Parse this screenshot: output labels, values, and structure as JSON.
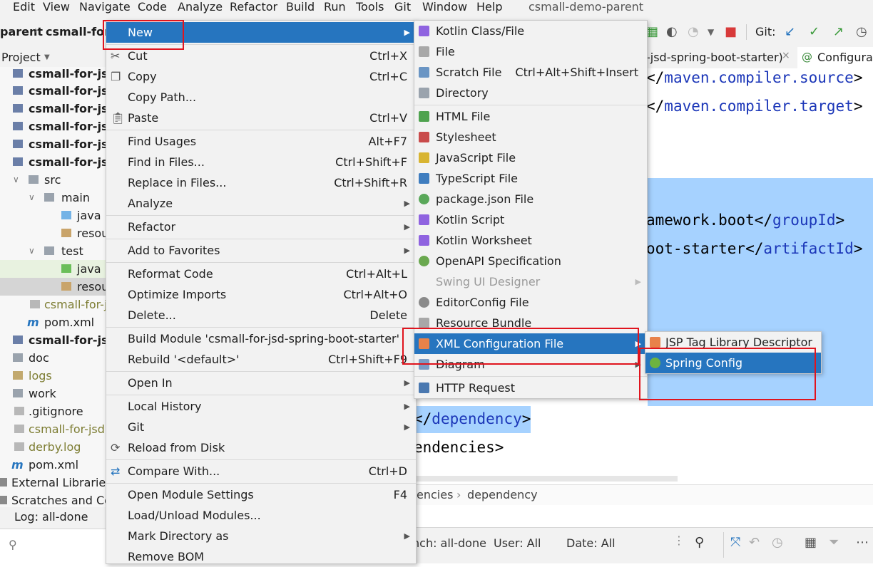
{
  "menubar": {
    "items": [
      "Edit",
      "View",
      "Navigate",
      "Code",
      "Analyze",
      "Refactor",
      "Build",
      "Run",
      "Tools",
      "Git",
      "Window",
      "Help"
    ],
    "app_title": "csmall-demo-parent"
  },
  "toolbar": {
    "breadcrumb_parent": "parent",
    "breadcrumb_module": "csmall-for",
    "git_label": "Git:"
  },
  "editor_tabs": {
    "tab1": "-jsd-spring-boot-starter)",
    "tab2": "Configura"
  },
  "project_panel": {
    "header": "Project",
    "rows": [
      "csmall-for-jsd",
      "csmall-for-jsd",
      "csmall-for-jsd",
      "csmall-for-jsd",
      "csmall-for-jsd",
      "csmall-for-jsd",
      "src",
      "main",
      "java",
      "resou",
      "test",
      "java",
      "resou",
      "csmall-for-j",
      "pom.xml",
      "csmall-for-jsd",
      "doc",
      "logs",
      "work",
      ".gitignore",
      "csmall-for-jsd.",
      "derby.log",
      "pom.xml",
      "External Libraries",
      "Scratches and Co"
    ]
  },
  "editor": {
    "line1_pre": "</",
    "line1_tag": "maven.compiler.source",
    "line1_post": ">",
    "line2_pre": "</",
    "line2_tag": "maven.compiler.target",
    "line2_post": ">",
    "line3_text": "amework.boot</",
    "line3_tag": "groupId",
    "line3_post": ">",
    "line4_text": "oot-starter</",
    "line4_tag": "artifactId",
    "line4_post": ">",
    "line5_pre": "</",
    "line5_tag": "dependency",
    "line5_post": ">",
    "line6_text": "endencies>"
  },
  "breadcrumb_bottom": {
    "item1": "encies",
    "item2": "dependency"
  },
  "git_panel": {
    "log_tab": "Log: all-done",
    "branch": "nch: all-done",
    "user": "User: All",
    "date": "Date: All"
  },
  "main_menu": {
    "items": [
      {
        "label": "New",
        "shortcut": ""
      },
      {
        "label": "Cut",
        "shortcut": "Ctrl+X"
      },
      {
        "label": "Copy",
        "shortcut": "Ctrl+C"
      },
      {
        "label": "Copy Path...",
        "shortcut": ""
      },
      {
        "label": "Paste",
        "shortcut": "Ctrl+V"
      },
      {
        "label": "Find Usages",
        "shortcut": "Alt+F7"
      },
      {
        "label": "Find in Files...",
        "shortcut": "Ctrl+Shift+F"
      },
      {
        "label": "Replace in Files...",
        "shortcut": "Ctrl+Shift+R"
      },
      {
        "label": "Analyze",
        "shortcut": ""
      },
      {
        "label": "Refactor",
        "shortcut": ""
      },
      {
        "label": "Add to Favorites",
        "shortcut": ""
      },
      {
        "label": "Reformat Code",
        "shortcut": "Ctrl+Alt+L"
      },
      {
        "label": "Optimize Imports",
        "shortcut": "Ctrl+Alt+O"
      },
      {
        "label": "Delete...",
        "shortcut": "Delete"
      },
      {
        "label": "Build Module 'csmall-for-jsd-spring-boot-starter'",
        "shortcut": ""
      },
      {
        "label": "Rebuild '<default>'",
        "shortcut": "Ctrl+Shift+F9"
      },
      {
        "label": "Open In",
        "shortcut": ""
      },
      {
        "label": "Local History",
        "shortcut": ""
      },
      {
        "label": "Git",
        "shortcut": ""
      },
      {
        "label": "Reload from Disk",
        "shortcut": ""
      },
      {
        "label": "Compare With...",
        "shortcut": "Ctrl+D"
      },
      {
        "label": "Open Module Settings",
        "shortcut": "F4"
      },
      {
        "label": "Load/Unload Modules...",
        "shortcut": ""
      },
      {
        "label": "Mark Directory as",
        "shortcut": ""
      },
      {
        "label": "Remove BOM",
        "shortcut": ""
      }
    ]
  },
  "new_menu": {
    "items": [
      {
        "label": "Kotlin Class/File",
        "shortcut": ""
      },
      {
        "label": "File",
        "shortcut": ""
      },
      {
        "label": "Scratch File",
        "shortcut": "Ctrl+Alt+Shift+Insert"
      },
      {
        "label": "Directory",
        "shortcut": ""
      },
      {
        "label": "HTML File",
        "shortcut": ""
      },
      {
        "label": "Stylesheet",
        "shortcut": ""
      },
      {
        "label": "JavaScript File",
        "shortcut": ""
      },
      {
        "label": "TypeScript File",
        "shortcut": ""
      },
      {
        "label": "package.json File",
        "shortcut": ""
      },
      {
        "label": "Kotlin Script",
        "shortcut": ""
      },
      {
        "label": "Kotlin Worksheet",
        "shortcut": ""
      },
      {
        "label": "OpenAPI Specification",
        "shortcut": ""
      },
      {
        "label": "Swing UI Designer",
        "shortcut": ""
      },
      {
        "label": "EditorConfig File",
        "shortcut": ""
      },
      {
        "label": "Resource Bundle",
        "shortcut": ""
      },
      {
        "label": "XML Configuration File",
        "shortcut": ""
      },
      {
        "label": "Diagram",
        "shortcut": ""
      },
      {
        "label": "HTTP Request",
        "shortcut": ""
      }
    ]
  },
  "xml_menu": {
    "items": [
      {
        "label": "JSP Tag Library Descriptor"
      },
      {
        "label": "Spring Config"
      }
    ]
  },
  "colors": {
    "menu_bg": "#f2f2f2",
    "selection": "#2675bf",
    "annotation_red": "#e0141e",
    "code_tag": "#1b36b8",
    "editor_highlight": "#a6d2ff"
  }
}
